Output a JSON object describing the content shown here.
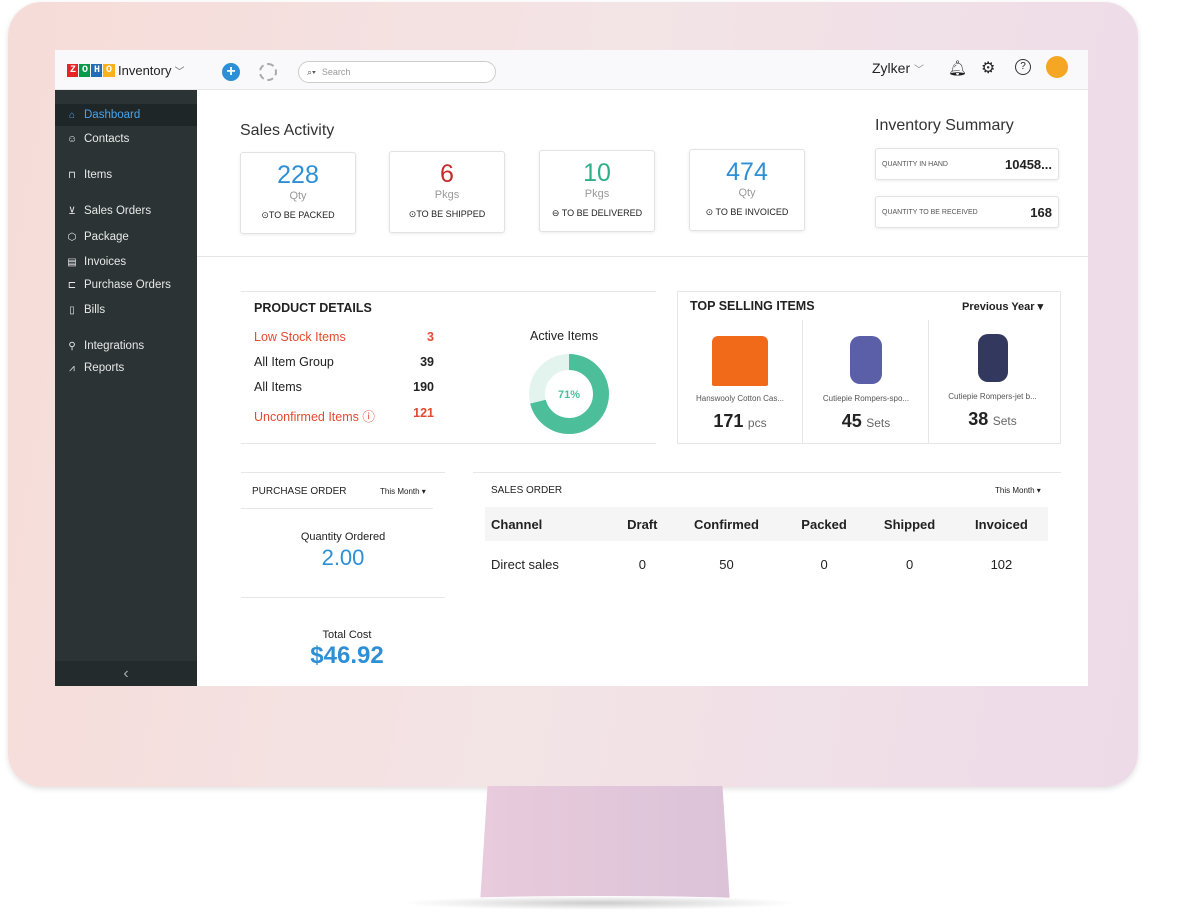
{
  "app": {
    "brand": "ZOHO",
    "name": "Inventory",
    "search_placeholder": "Search",
    "org": "Zylker"
  },
  "sidebar": {
    "items": [
      {
        "label": "Dashboard",
        "icon": "home-icon"
      },
      {
        "label": "Contacts",
        "icon": "user-icon"
      },
      {
        "label": "Items",
        "icon": "basket-icon"
      },
      {
        "label": "Sales Orders",
        "icon": "cart-icon"
      },
      {
        "label": "Package",
        "icon": "box-icon"
      },
      {
        "label": "Invoices",
        "icon": "invoice-icon"
      },
      {
        "label": "Purchase Orders",
        "icon": "bag-icon"
      },
      {
        "label": "Bills",
        "icon": "bill-icon"
      },
      {
        "label": "Integrations",
        "icon": "plug-icon"
      },
      {
        "label": "Reports",
        "icon": "chart-icon"
      }
    ]
  },
  "sales_activity": {
    "title": "Sales Activity",
    "cards": [
      {
        "value": "228",
        "unit": "Qty",
        "label": "TO BE PACKED",
        "color": "#2d8fd5"
      },
      {
        "value": "6",
        "unit": "Pkgs",
        "label": "TO BE SHIPPED",
        "color": "#c62a2a"
      },
      {
        "value": "10",
        "unit": "Pkgs",
        "label": "TO BE DELIVERED",
        "color": "#2fae8c"
      },
      {
        "value": "474",
        "unit": "Qty",
        "label": "TO BE INVOICED",
        "color": "#2d8fd5"
      }
    ]
  },
  "inventory_summary": {
    "title": "Inventory Summary",
    "rows": [
      {
        "label": "QUANTITY IN HAND",
        "value": "10458..."
      },
      {
        "label": "QUANTITY TO BE RECEIVED",
        "value": "168"
      }
    ]
  },
  "product_details": {
    "title": "PRODUCT DETAILS",
    "rows": [
      {
        "label": "Low Stock Items",
        "value": "3"
      },
      {
        "label": "All Item Group",
        "value": "39"
      },
      {
        "label": "All Items",
        "value": "190"
      },
      {
        "label": "Unconfirmed Items",
        "value": "121"
      }
    ],
    "active_items_title": "Active Items",
    "active_pct": 71,
    "active_label": "71%"
  },
  "top_selling": {
    "title": "TOP SELLING ITEMS",
    "period": "Previous Year",
    "items": [
      {
        "name": "Hanswooly Cotton Cas...",
        "qty": "171",
        "unit": "pcs"
      },
      {
        "name": "Cutiepie Rompers-spo...",
        "qty": "45",
        "unit": "Sets"
      },
      {
        "name": "Cutiepie Rompers-jet b...",
        "qty": "38",
        "unit": "Sets"
      }
    ]
  },
  "purchase_order": {
    "title": "PURCHASE ORDER",
    "period": "This Month",
    "qty_label": "Quantity Ordered",
    "qty": "2.00",
    "cost_label": "Total Cost",
    "cost": "$46.92"
  },
  "sales_order": {
    "title": "SALES ORDER",
    "period": "This Month",
    "columns": [
      "Channel",
      "Draft",
      "Confirmed",
      "Packed",
      "Shipped",
      "Invoiced"
    ],
    "rows": [
      [
        "Direct sales",
        "0",
        "50",
        "0",
        "0",
        "102"
      ]
    ]
  }
}
